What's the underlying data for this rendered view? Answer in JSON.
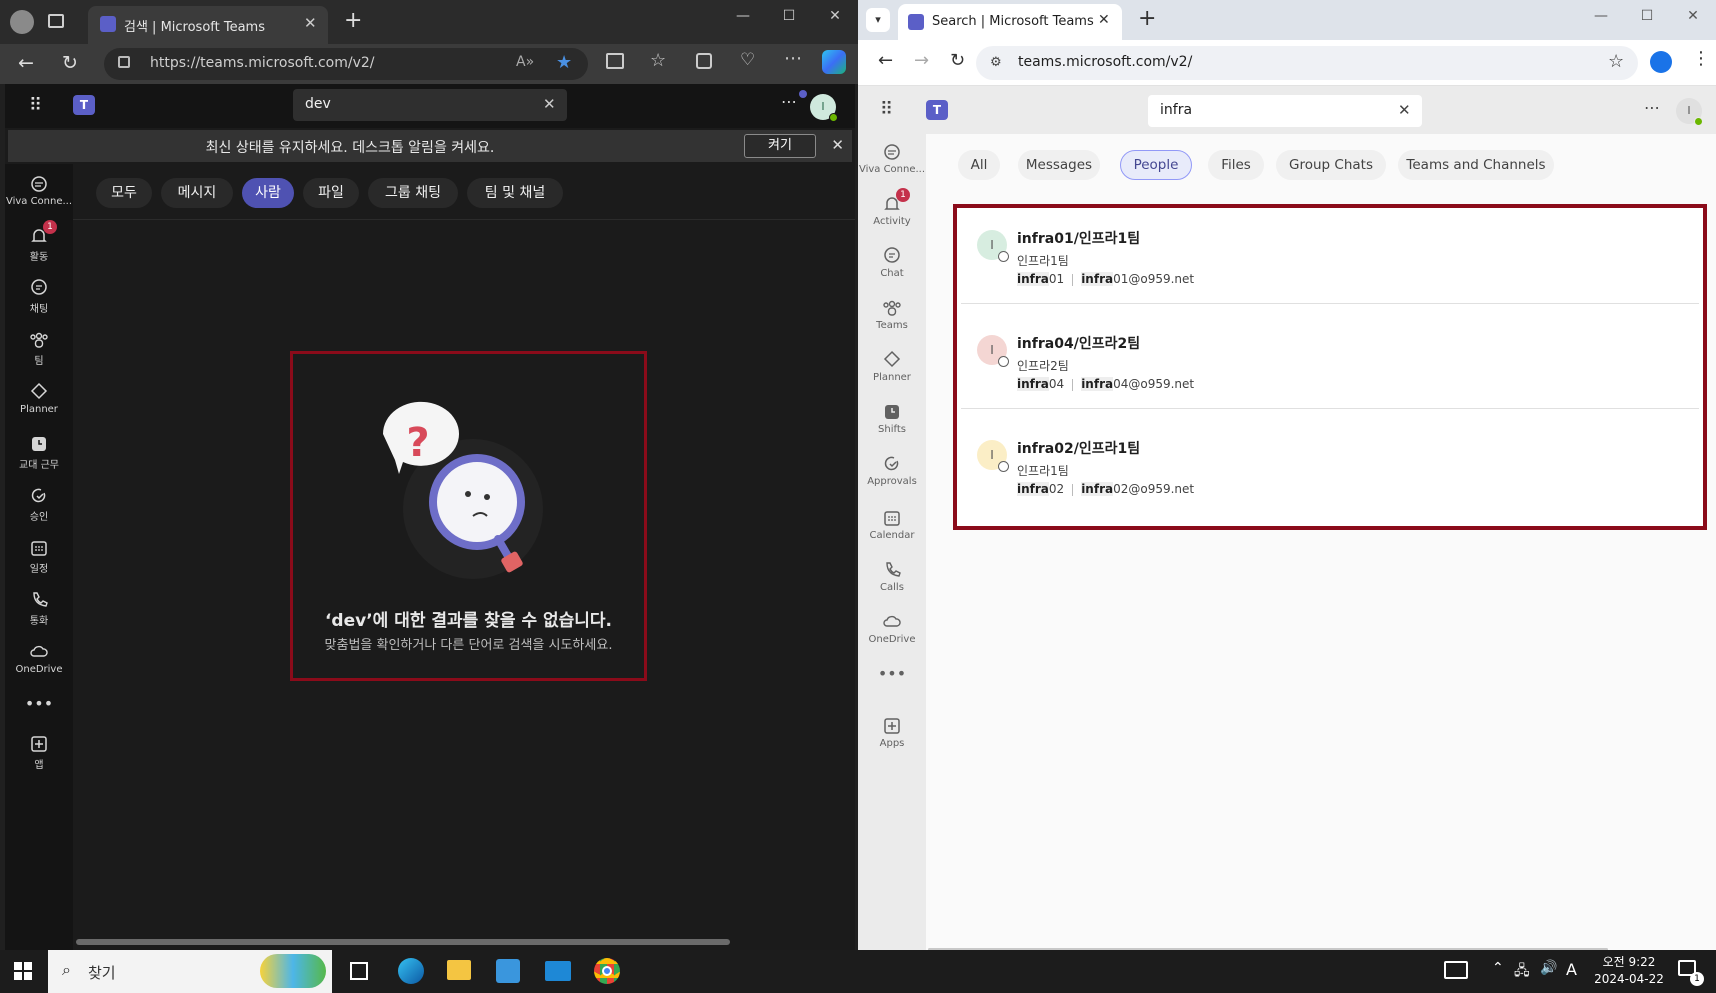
{
  "left_browser": {
    "tab_title": "검색 | Microsoft Teams",
    "url": "https://teams.microsoft.com/v2/",
    "search_query": "dev",
    "notification_text": "최신 상태를 유지하세요. 데스크톱 알림을 켜세요.",
    "notification_button": "켜기",
    "rail": [
      {
        "label": "Viva Conne...",
        "icon": "viva-icon"
      },
      {
        "label": "활동",
        "icon": "bell-icon",
        "badge": "1"
      },
      {
        "label": "채팅",
        "icon": "chat-icon"
      },
      {
        "label": "팀",
        "icon": "teams-icon"
      },
      {
        "label": "Planner",
        "icon": "planner-icon"
      },
      {
        "label": "교대 근무",
        "icon": "shifts-icon"
      },
      {
        "label": "승인",
        "icon": "approvals-icon"
      },
      {
        "label": "일정",
        "icon": "calendar-icon"
      },
      {
        "label": "통화",
        "icon": "phone-icon"
      },
      {
        "label": "OneDrive",
        "icon": "cloud-icon"
      },
      {
        "label": "앱",
        "icon": "add-app-icon"
      }
    ],
    "filters": [
      "모두",
      "메시지",
      "사람",
      "파일",
      "그룹 채팅",
      "팀 및 채널"
    ],
    "active_filter": "사람",
    "empty_title": "‘dev’에 대한 결과를 찾을 수 없습니다.",
    "empty_subtitle": "맞춤법을 확인하거나 다른 단어로 검색을 시도하세요."
  },
  "right_browser": {
    "tab_title": "Search | Microsoft Teams",
    "url": "teams.microsoft.com/v2/",
    "search_query": "infra",
    "rail": [
      {
        "label": "Viva Conne...",
        "icon": "viva-icon"
      },
      {
        "label": "Activity",
        "icon": "bell-icon",
        "badge": "1"
      },
      {
        "label": "Chat",
        "icon": "chat-icon"
      },
      {
        "label": "Teams",
        "icon": "teams-icon"
      },
      {
        "label": "Planner",
        "icon": "planner-icon"
      },
      {
        "label": "Shifts",
        "icon": "shifts-icon"
      },
      {
        "label": "Approvals",
        "icon": "approvals-icon"
      },
      {
        "label": "Calendar",
        "icon": "calendar-icon"
      },
      {
        "label": "Calls",
        "icon": "phone-icon"
      },
      {
        "label": "OneDrive",
        "icon": "cloud-icon"
      },
      {
        "label": "Apps",
        "icon": "add-app-icon"
      }
    ],
    "filters": [
      "All",
      "Messages",
      "People",
      "Files",
      "Group Chats",
      "Teams and Channels"
    ],
    "active_filter": "People",
    "results": [
      {
        "initial": "I",
        "name_hl": "infra",
        "name_rest": "01/인프라1팀",
        "dept": "인프라1팀",
        "user_hl": "infra",
        "user_rest": "01",
        "email_hl": "infra",
        "email_rest": "01@o959.net",
        "avatar_color": "#d7ede0"
      },
      {
        "initial": "I",
        "name_hl": "infra",
        "name_rest": "04/인프라2팀",
        "dept": "인프라2팀",
        "user_hl": "infra",
        "user_rest": "04",
        "email_hl": "infra",
        "email_rest": "04@o959.net",
        "avatar_color": "#f4d6d3"
      },
      {
        "initial": "I",
        "name_hl": "infra",
        "name_rest": "02/인프라1팀",
        "dept": "인프라1팀",
        "user_hl": "infra",
        "user_rest": "02",
        "email_hl": "infra",
        "email_rest": "02@o959.net",
        "avatar_color": "#fbeec6"
      }
    ]
  },
  "taskbar": {
    "search_placeholder": "찾기",
    "time": "오전 9:22",
    "date": "2024-04-22",
    "ime": "A",
    "notification_count": "1"
  },
  "colors": {
    "teams_purple": "#4f52b2",
    "highlight_border": "#8b0b1a",
    "badge_red": "#c4314b"
  }
}
